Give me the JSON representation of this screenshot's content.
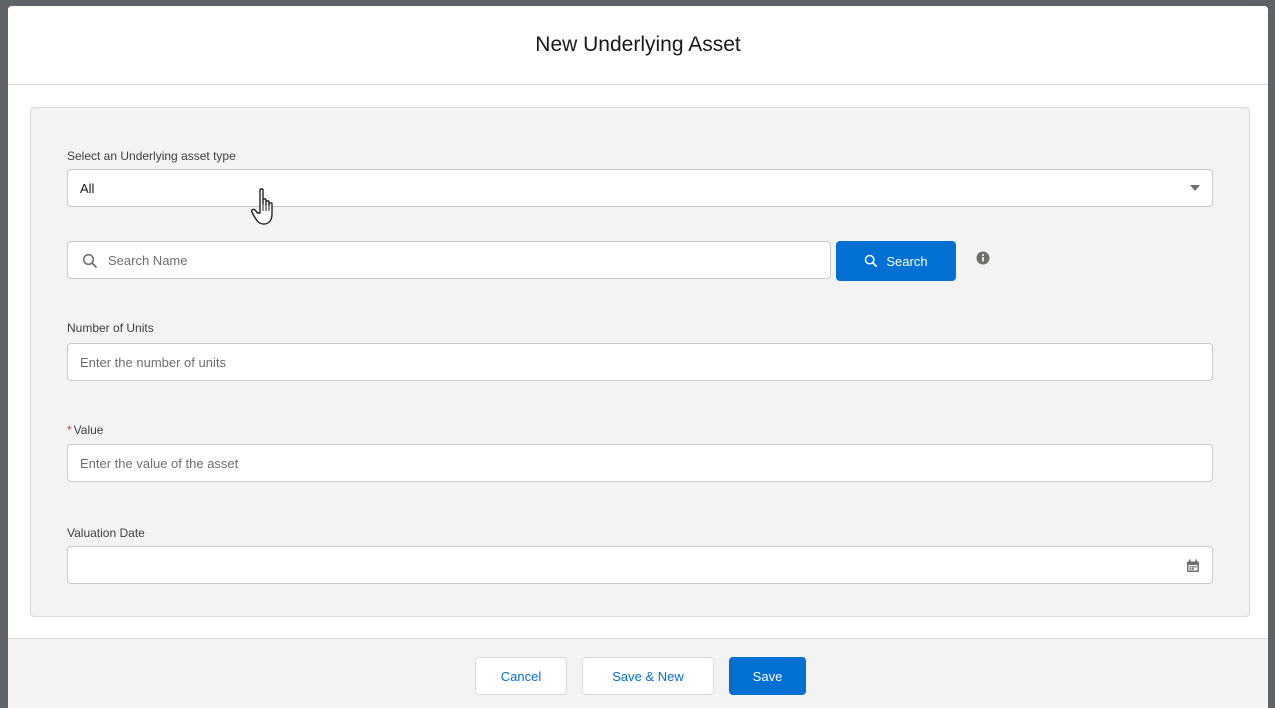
{
  "modal": {
    "title": "New Underlying Asset"
  },
  "asset_type": {
    "label": "Select an Underlying asset type",
    "value": "All"
  },
  "search": {
    "placeholder": "Search Name",
    "button_label": "Search"
  },
  "units": {
    "label": "Number of Units",
    "placeholder": "Enter the number of units"
  },
  "value": {
    "required_marker": "*",
    "label": "Value",
    "placeholder": "Enter the value of the asset"
  },
  "valuation_date": {
    "label": "Valuation Date",
    "value": ""
  },
  "footer": {
    "cancel_label": "Cancel",
    "save_new_label": "Save & New",
    "save_label": "Save"
  },
  "icons": [
    "search-icon",
    "info-icon",
    "calendar-icon",
    "chevron-down-icon",
    "hand-cursor-icon"
  ],
  "colors": {
    "brand": "#0070d2",
    "panel": "#f3f3f3",
    "required": "#c23934"
  }
}
